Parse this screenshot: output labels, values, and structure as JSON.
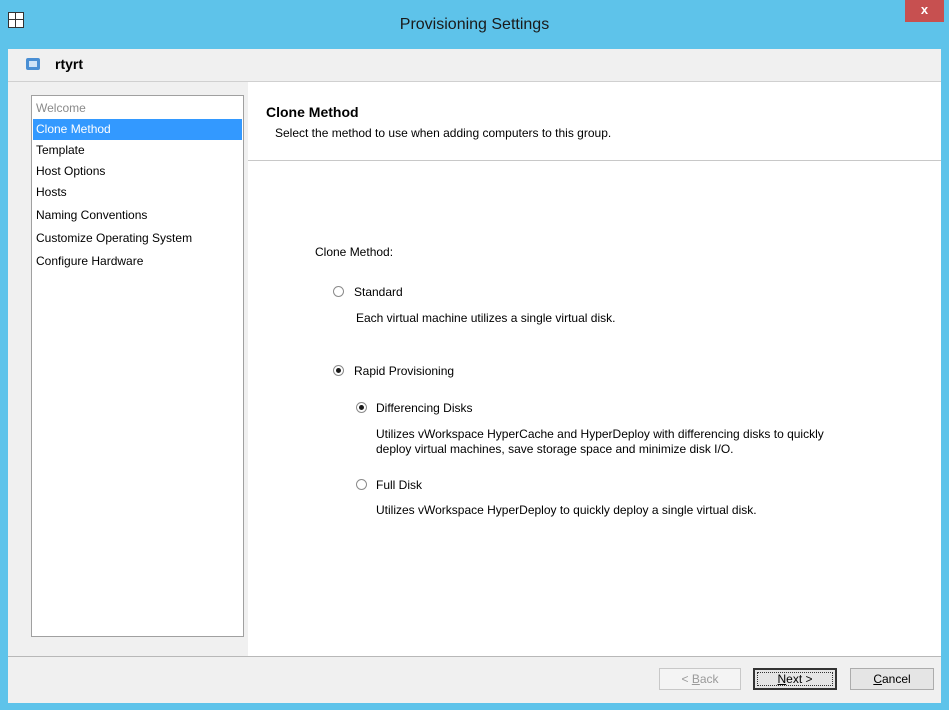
{
  "window": {
    "title": "Provisioning Settings",
    "close_label": "x"
  },
  "group": {
    "name": "rtyrt"
  },
  "nav": {
    "items": [
      {
        "label": "Welcome"
      },
      {
        "label": "Clone Method"
      },
      {
        "label": "Template"
      },
      {
        "label": "Host Options"
      },
      {
        "label": "Hosts"
      },
      {
        "label": "Naming Conventions"
      },
      {
        "label": "Customize Operating System"
      },
      {
        "label": "Configure Hardware"
      }
    ],
    "selected": "Clone Method"
  },
  "page": {
    "title": "Clone Method",
    "description": "Select the method to use when adding computers to this group.",
    "clone_method_label": "Clone Method:",
    "standard": {
      "label": "Standard",
      "desc": "Each virtual machine utilizes a single virtual disk.",
      "checked": false
    },
    "rapid": {
      "label": "Rapid Provisioning",
      "checked": true
    },
    "differencing": {
      "label": "Differencing Disks",
      "desc_line1": "Utilizes vWorkspace HyperCache and HyperDeploy with differencing disks to quickly",
      "desc_line2": "deploy virtual machines, save storage space and minimize disk I/O.",
      "checked": true
    },
    "full_disk": {
      "label": "Full Disk",
      "desc": "Utilizes vWorkspace HyperDeploy to quickly deploy a single virtual disk.",
      "checked": false
    }
  },
  "buttons": {
    "back_prefix": "< ",
    "back_key": "B",
    "back_rest": "ack",
    "next_key": "N",
    "next_rest": "ext >",
    "cancel_key": "C",
    "cancel_rest": "ancel"
  },
  "colors": {
    "titlebar": "#5ec3ea",
    "selection": "#3399ff",
    "close": "#c75050"
  }
}
